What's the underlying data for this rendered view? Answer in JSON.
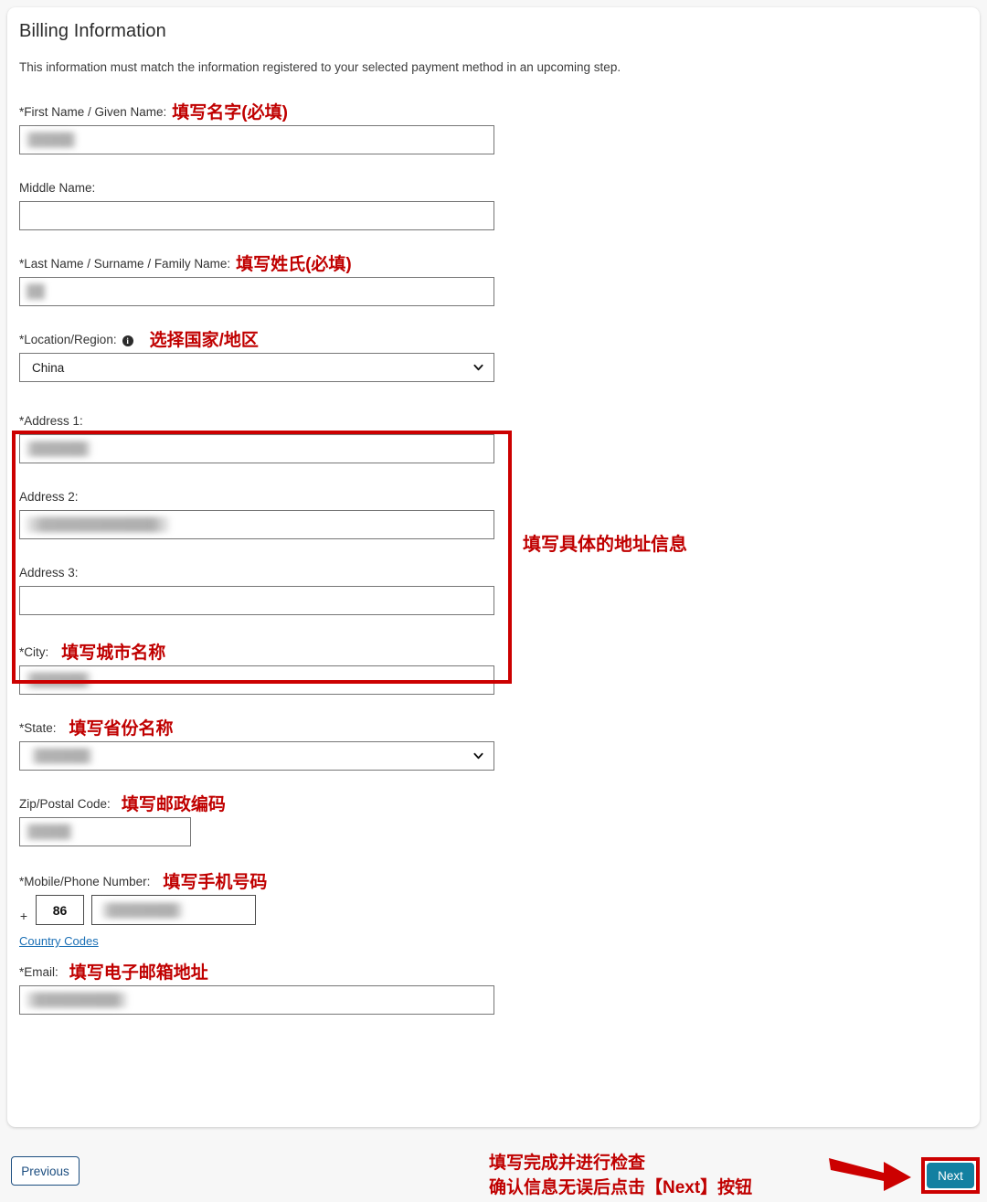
{
  "card": {
    "title": "Billing Information",
    "description": "This information must match the information registered to your selected payment method in an upcoming step."
  },
  "colors": {
    "annotation_red": "#c00000",
    "highlight_box_red": "#cc0000",
    "next_button_teal": "#1380a1",
    "previous_button_blue": "#1c4e80",
    "link_blue": "#1a6fb5"
  },
  "fields": {
    "first_name": {
      "label": "*First Name / Given Name:",
      "annotation": "填写名字(必填)",
      "value": "",
      "redacted": true,
      "redact_width": 56
    },
    "middle_name": {
      "label": "Middle Name:",
      "annotation": "",
      "value": "",
      "redacted": false
    },
    "last_name": {
      "label": "*Last Name / Surname / Family Name:",
      "annotation": "填写姓氏(必填)",
      "value": "",
      "redacted": true,
      "redact_width": 22
    },
    "location_region": {
      "label": "*Location/Region:",
      "annotation": "选择国家/地区",
      "value": "China",
      "info_icon": "i",
      "icon": "info-icon"
    },
    "address1": {
      "label": "*Address 1:",
      "annotation": "",
      "value": "",
      "redacted": true,
      "redact_width": 72
    },
    "address2": {
      "label": "Address 2:",
      "annotation": "",
      "value": "",
      "redacted": true,
      "redact_width": 158
    },
    "address3": {
      "label": "Address 3:",
      "annotation": "",
      "value": "",
      "redacted": false
    },
    "city": {
      "label": "*City:",
      "annotation": "填写城市名称",
      "value": "",
      "redacted": true,
      "redact_width": 72
    },
    "state": {
      "label": "*State:",
      "annotation": "填写省份名称",
      "value": "",
      "redacted": true,
      "redact_width": 68
    },
    "zip": {
      "label": "Zip/Postal Code:",
      "annotation": "填写邮政编码",
      "value": "",
      "redacted": true,
      "redact_width": 52
    },
    "phone": {
      "label": "*Mobile/Phone Number:",
      "annotation": "填写手机号码",
      "plus": "+",
      "country_code": "86",
      "number": "",
      "redacted": true,
      "redact_width": 90,
      "country_codes_link": "Country Codes"
    },
    "email": {
      "label": "*Email:",
      "annotation": "填写电子邮箱地址",
      "value": "",
      "redacted": true,
      "redact_width": 112
    }
  },
  "address_group": {
    "side_annotation": "填写具体的地址信息"
  },
  "footer": {
    "previous_label": "Previous",
    "next_label": "Next",
    "annotation_line1": "填写完成并进行检查",
    "annotation_line2": "确认信息无误后点击【Next】按钮",
    "arrow_icon": "arrow-right-icon"
  }
}
